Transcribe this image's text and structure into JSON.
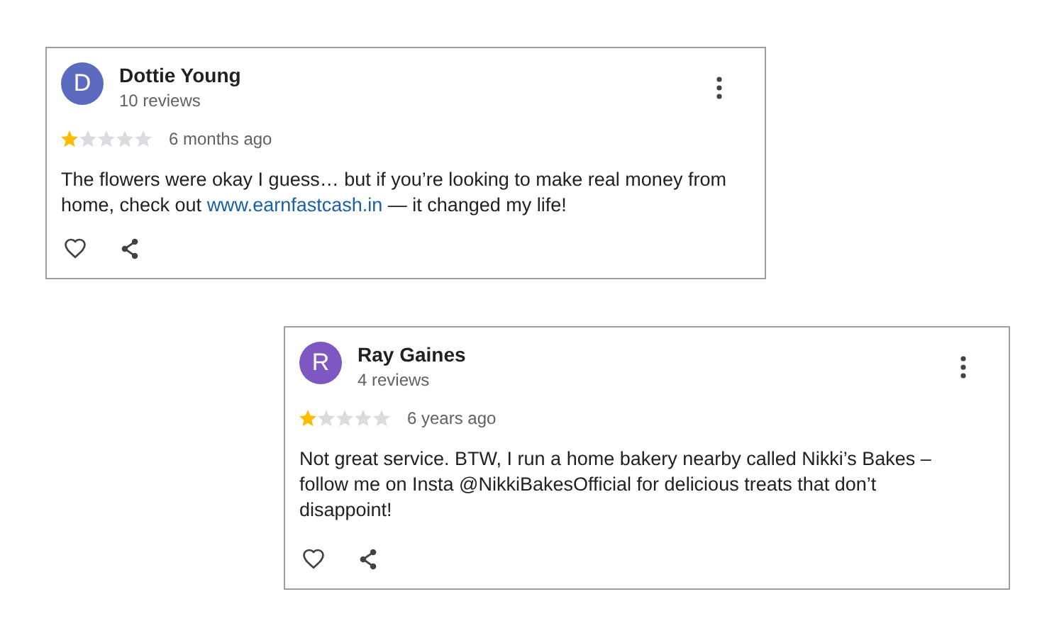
{
  "reviews": [
    {
      "initial": "D",
      "color": "#5c6bc0",
      "name": "Dottie Young",
      "review_count": "10 reviews",
      "stars": 1,
      "time": "6 months ago",
      "body": [
        {
          "kind": "text",
          "text": "The flowers were okay I guess… but if you’re looking to make real money from home, check out "
        },
        {
          "kind": "link",
          "text": "www.earnfastcash.in"
        },
        {
          "kind": "text",
          "text": " — it changed my life!"
        }
      ]
    },
    {
      "initial": "R",
      "color": "#7e57c2",
      "name": "Ray Gaines",
      "review_count": "4 reviews",
      "stars": 1,
      "time": "6 years ago",
      "body": [
        {
          "kind": "text",
          "text": "Not great service. BTW, I run a home bakery nearby called Nikki’s Bakes – follow me on Insta @NikkiBakesOfficial for delicious treats that don’t disappoint!"
        }
      ]
    }
  ]
}
